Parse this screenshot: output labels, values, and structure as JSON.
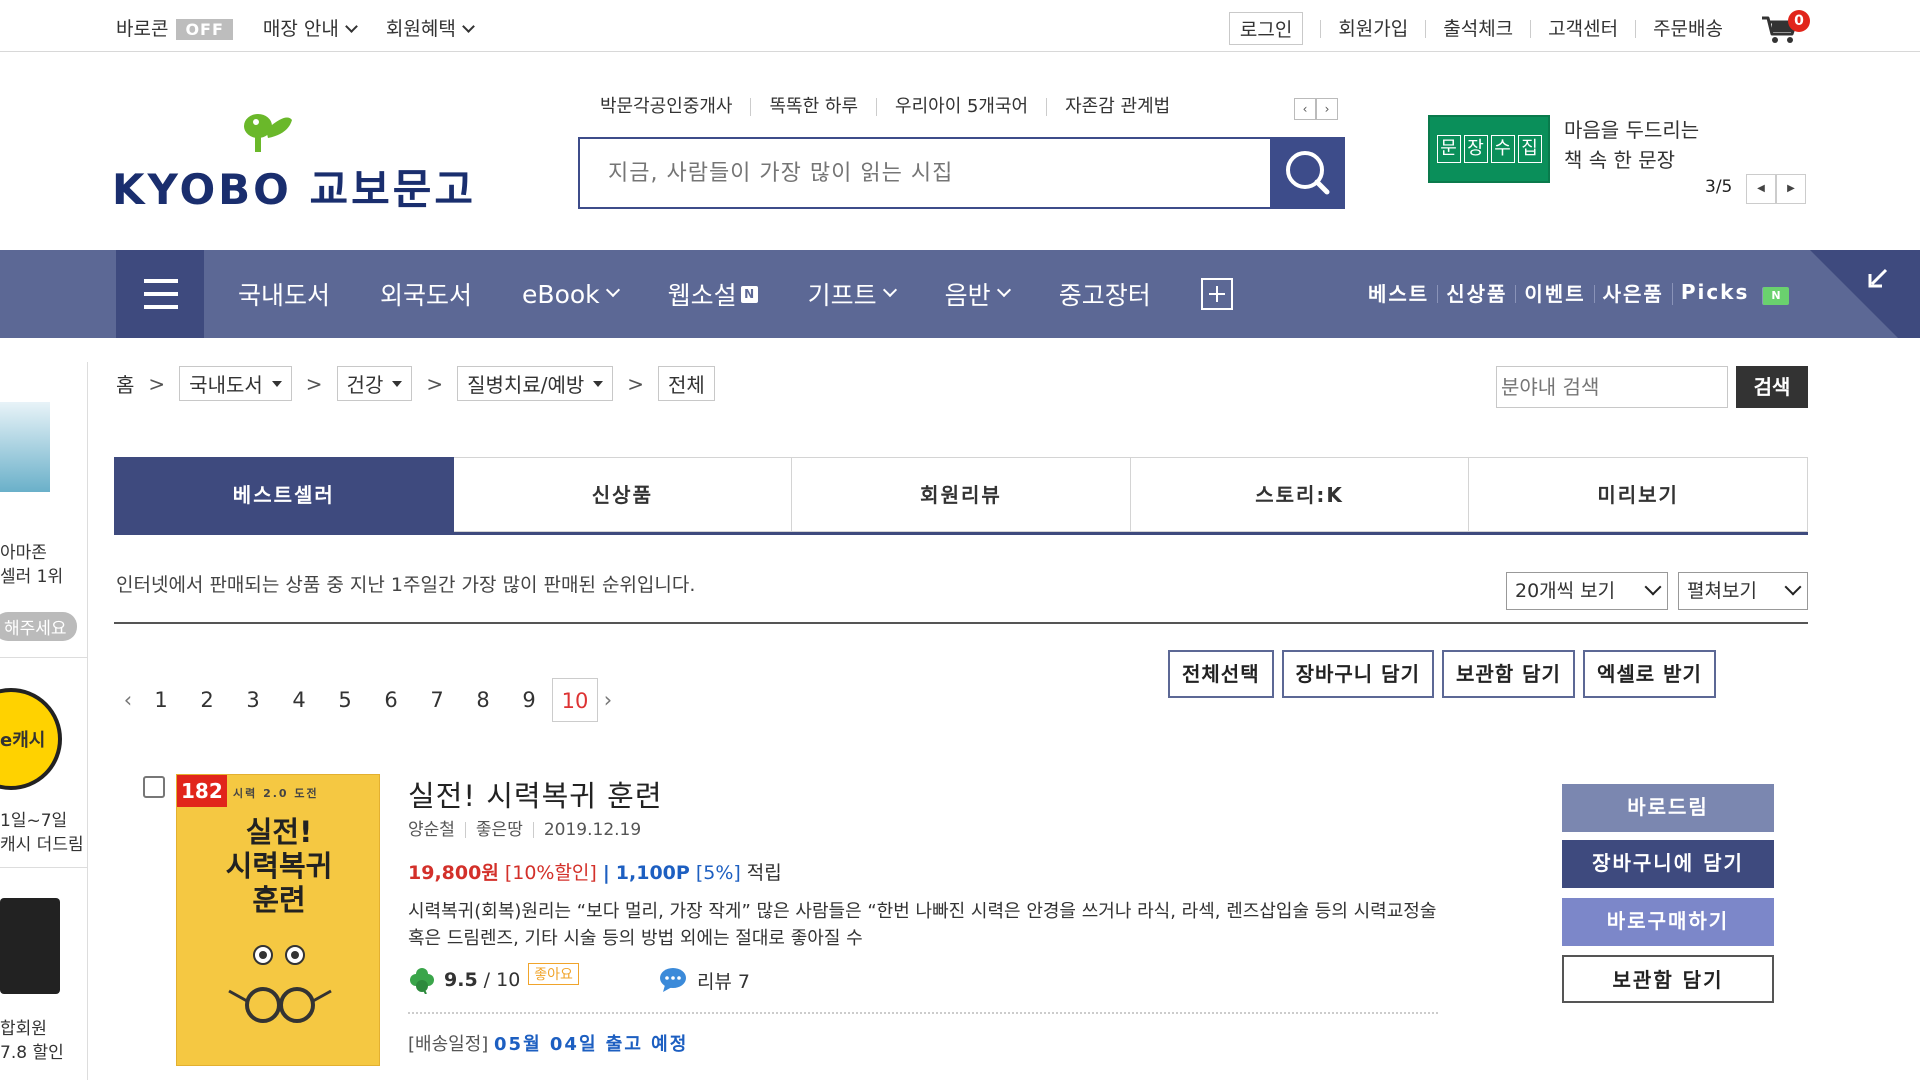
{
  "topbar": {
    "baro_label": "바로콘",
    "baro_state": "OFF",
    "store_guide": "매장 안내",
    "member_benefit": "회원혜택",
    "login": "로그인",
    "signup": "회원가입",
    "attendance": "출석체크",
    "customer_center": "고객센터",
    "order_delivery": "주문배송",
    "cart_count": "0"
  },
  "header": {
    "logo_en": "KYOBO",
    "logo_ko": "교보문고",
    "keywords": [
      "박문각공인중개사",
      "똑똑한 하루",
      "우리아이 5개국어",
      "자존감 관계법"
    ],
    "search_placeholder": "지금, 사람들이 가장 많이 읽는 시집",
    "banner_chars": [
      "문",
      "장",
      "수",
      "집"
    ],
    "banner_line1": "마음을 두드리는",
    "banner_line2": "책 속 한 문장",
    "banner_page": "3/5"
  },
  "nav": {
    "items": [
      "국내도서",
      "외국도서",
      "eBook",
      "웹소설",
      "기프트",
      "음반",
      "중고장터"
    ],
    "new_badge": "N",
    "right_links": [
      "베스트",
      "신상품",
      "이벤트",
      "사은품",
      "Picks"
    ],
    "picks_badge": "N"
  },
  "side": {
    "t1": "아마존",
    "t2": "셀러 1위",
    "t3": "해주세요",
    "t4": "e캐시",
    "t5": "1일~7일",
    "t6": "캐시 더드림",
    "t7": "합회원",
    "t8": "7.8 할인"
  },
  "breadcrumb": {
    "home": "홈",
    "level1": "국내도서",
    "level2": "건강",
    "level3": "질병치료/예방",
    "level4": "전체",
    "search_placeholder": "분야내 검색",
    "search_button": "검색"
  },
  "tabs": [
    "베스트셀러",
    "신상품",
    "회원리뷰",
    "스토리:K",
    "미리보기"
  ],
  "list": {
    "description": "인터넷에서 판매되는 상품 중 지난 1주일간 가장 많이 판매된 순위입니다.",
    "per_page": "20개씩 보기",
    "view_mode": "펼쳐보기",
    "pages": [
      "1",
      "2",
      "3",
      "4",
      "5",
      "6",
      "7",
      "8",
      "9",
      "10"
    ],
    "current_page": "10",
    "actions": [
      "전체선택",
      "장바구니 담기",
      "보관함 담기",
      "엑셀로 받기"
    ]
  },
  "product": {
    "rank": "182",
    "cover_sub": "시력 2.0 도전",
    "cover_title_1": "실전!",
    "cover_title_2": "시력복귀",
    "cover_title_3": "훈련",
    "title": "실전! 시력복귀 훈련",
    "author": "양순철",
    "publisher": "좋은땅",
    "date": "2019.12.19",
    "price": "19,800원",
    "discount": "[10%할인]",
    "sep": "|",
    "points": "1,100P",
    "points_rate": "[5%]",
    "points_label": "적립",
    "summary": "시력복귀(회복)원리는 “보다 멀리, 가장 작게” 많은 사람들은 “한번 나빠진 시력은 안경을 쓰거나 라식, 라섹, 렌즈삽입술 등의 시력교정술 혹은 드림렌즈, 기타 시술 등의 방법 외에는 절대로 좋아질 수",
    "rating": "9.5",
    "rating_max": "/ 10",
    "like": "좋아요",
    "review": "리뷰 7",
    "ship_label": "[배송일정]",
    "ship_value": "05월 04일 출고 예정",
    "buttons": [
      "바로드림",
      "장바구니에 담기",
      "바로구매하기",
      "보관함 담기"
    ]
  }
}
